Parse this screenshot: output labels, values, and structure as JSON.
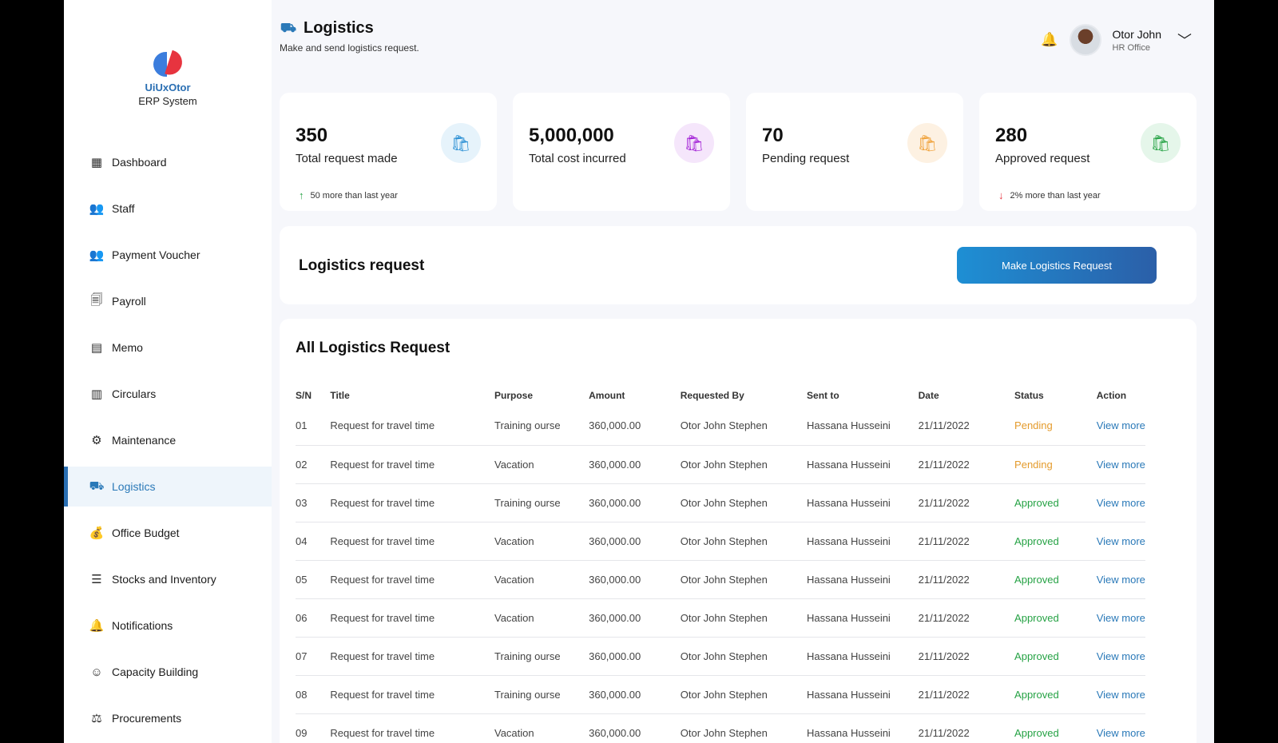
{
  "brand": {
    "name": "UiUxOtor",
    "subtitle": "ERP System"
  },
  "sidebar": {
    "items": [
      {
        "label": "Dashboard",
        "icon": "grid-icon",
        "glyph": "▦"
      },
      {
        "label": "Staff",
        "icon": "users-icon",
        "glyph": "👥"
      },
      {
        "label": "Payment Voucher",
        "icon": "users-icon",
        "glyph": "👥"
      },
      {
        "label": "Payroll",
        "icon": "payroll-icon",
        "glyph": "🗐"
      },
      {
        "label": "Memo",
        "icon": "memo-icon",
        "glyph": "▤"
      },
      {
        "label": "Circulars",
        "icon": "document-icon",
        "glyph": "▥"
      },
      {
        "label": "Maintenance",
        "icon": "gears-icon",
        "glyph": "⚙"
      },
      {
        "label": "Logistics",
        "icon": "logistics-icon",
        "glyph": "⛟",
        "active": true
      },
      {
        "label": "Office Budget",
        "icon": "money-bag-icon",
        "glyph": "💰"
      },
      {
        "label": "Stocks and Inventory",
        "icon": "list-icon",
        "glyph": "☰"
      },
      {
        "label": "Notifications",
        "icon": "bell-icon",
        "glyph": "🔔"
      },
      {
        "label": "Capacity Building",
        "icon": "head-icon",
        "glyph": "☺"
      },
      {
        "label": "Procurements",
        "icon": "procurement-icon",
        "glyph": "⚖"
      }
    ]
  },
  "header": {
    "title": "Logistics",
    "subtitle": "Make and send logistics request."
  },
  "user": {
    "name": "Otor John",
    "role": "HR Office"
  },
  "cards": [
    {
      "value": "350",
      "label": "Total request made",
      "trend": "50 more than last year",
      "trend_dir": "up",
      "accent": "#2a8fd4",
      "bg": "#e6f3fb"
    },
    {
      "value": "5,000,000",
      "label": "Total cost incurred",
      "trend": "",
      "trend_dir": "",
      "accent": "#a21fd6",
      "bg": "#f5e6fb"
    },
    {
      "value": "70",
      "label": "Pending request",
      "trend": "",
      "trend_dir": "",
      "accent": "#f0a23a",
      "bg": "#fdf1e2"
    },
    {
      "value": "280",
      "label": "Approved request",
      "trend": "2% more than last year",
      "trend_dir": "down",
      "accent": "#25a244",
      "bg": "#e5f6ea"
    }
  ],
  "request_panel": {
    "title": "Logistics request",
    "button_label": "Make Logistics Request"
  },
  "table": {
    "title": "All Logistics Request",
    "columns": [
      "S/N",
      "Title",
      "Purpose",
      "Amount",
      "Requested By",
      "Sent to",
      "Date",
      "Status",
      "Action"
    ],
    "rows": [
      {
        "sn": "01",
        "title": "Request for travel time",
        "purpose": "Training ourse",
        "amount": "360,000.00",
        "requested_by": "Otor John Stephen",
        "sent_to": "Hassana Husseini",
        "date": "21/11/2022",
        "status": "Pending",
        "action": "View more"
      },
      {
        "sn": "02",
        "title": "Request for travel time",
        "purpose": "Vacation",
        "amount": "360,000.00",
        "requested_by": "Otor John Stephen",
        "sent_to": "Hassana Husseini",
        "date": "21/11/2022",
        "status": "Pending",
        "action": "View more"
      },
      {
        "sn": "03",
        "title": "Request for travel time",
        "purpose": "Training ourse",
        "amount": "360,000.00",
        "requested_by": "Otor John Stephen",
        "sent_to": "Hassana Husseini",
        "date": "21/11/2022",
        "status": "Approved",
        "action": "View more"
      },
      {
        "sn": "04",
        "title": "Request for travel time",
        "purpose": "Vacation",
        "amount": "360,000.00",
        "requested_by": "Otor John Stephen",
        "sent_to": "Hassana Husseini",
        "date": "21/11/2022",
        "status": "Approved",
        "action": "View more"
      },
      {
        "sn": "05",
        "title": "Request for travel time",
        "purpose": "Vacation",
        "amount": "360,000.00",
        "requested_by": "Otor John Stephen",
        "sent_to": "Hassana Husseini",
        "date": "21/11/2022",
        "status": "Approved",
        "action": "View more"
      },
      {
        "sn": "06",
        "title": "Request for travel time",
        "purpose": "Vacation",
        "amount": "360,000.00",
        "requested_by": "Otor John Stephen",
        "sent_to": "Hassana Husseini",
        "date": "21/11/2022",
        "status": "Approved",
        "action": "View more"
      },
      {
        "sn": "07",
        "title": "Request for travel time",
        "purpose": "Training ourse",
        "amount": "360,000.00",
        "requested_by": "Otor John Stephen",
        "sent_to": "Hassana Husseini",
        "date": "21/11/2022",
        "status": "Approved",
        "action": "View more"
      },
      {
        "sn": "08",
        "title": "Request for travel time",
        "purpose": "Training ourse",
        "amount": "360,000.00",
        "requested_by": "Otor John Stephen",
        "sent_to": "Hassana Husseini",
        "date": "21/11/2022",
        "status": "Approved",
        "action": "View more"
      },
      {
        "sn": "09",
        "title": "Request for travel time",
        "purpose": "Vacation",
        "amount": "360,000.00",
        "requested_by": "Otor John Stephen",
        "sent_to": "Hassana Husseini",
        "date": "21/11/2022",
        "status": "Approved",
        "action": "View more"
      }
    ]
  }
}
